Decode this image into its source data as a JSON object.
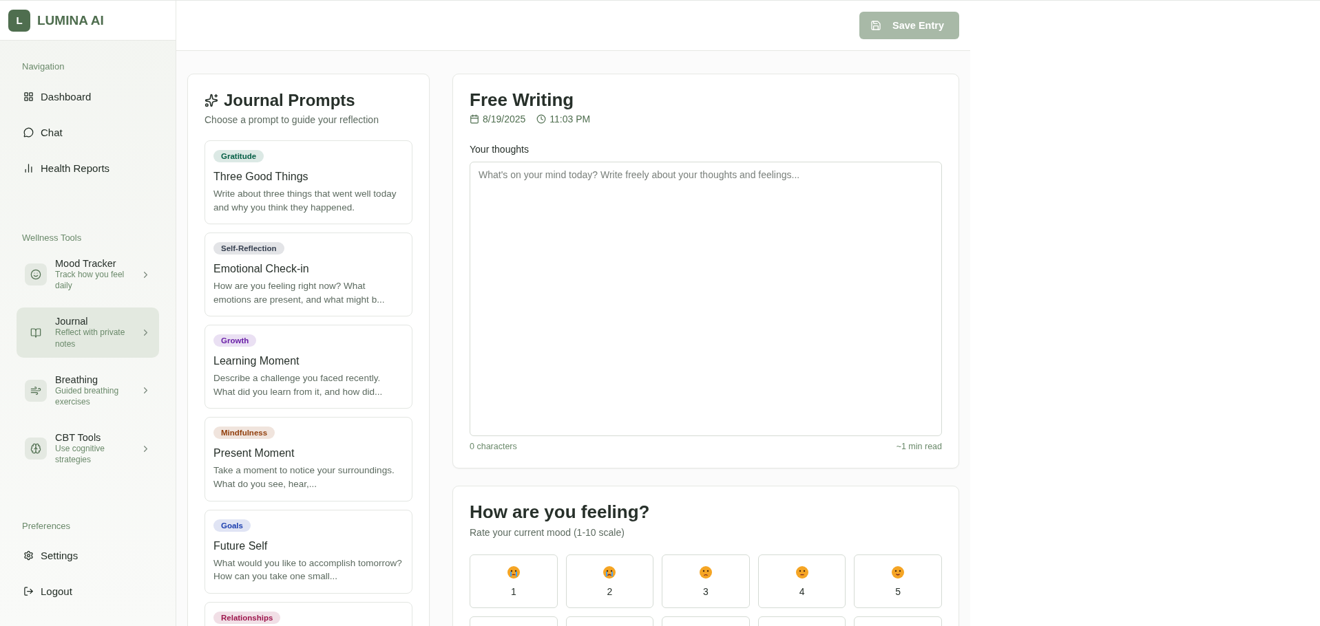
{
  "brand": {
    "logo_letter": "L",
    "name": "LUMINA AI"
  },
  "sidebar": {
    "sections": [
      {
        "title": "Navigation",
        "kind": "plain",
        "items": [
          {
            "label": "Dashboard"
          },
          {
            "label": "Chat"
          },
          {
            "label": "Health Reports"
          }
        ]
      },
      {
        "title": "Wellness Tools",
        "kind": "tool",
        "items": [
          {
            "label": "Mood Tracker",
            "subtitle": "Track how you feel daily",
            "selected": false
          },
          {
            "label": "Journal",
            "subtitle": "Reflect with private notes",
            "selected": true
          },
          {
            "label": "Breathing",
            "subtitle": "Guided breathing exercises",
            "selected": false
          },
          {
            "label": "CBT Tools",
            "subtitle": "Use cognitive strategies",
            "selected": false
          }
        ]
      },
      {
        "title": "Preferences",
        "kind": "plain",
        "items": [
          {
            "label": "Settings"
          },
          {
            "label": "Logout"
          }
        ]
      }
    ]
  },
  "toolbar": {
    "save_button": {
      "label": "Save Entry",
      "disabled": true
    }
  },
  "prompts": {
    "title": "Journal Prompts",
    "subtitle": "Choose a prompt to guide your reflection",
    "items": [
      {
        "tag": "Gratitude",
        "color": "#065f46",
        "title": "Three Good Things",
        "description": "Write about three things that went well today and why you think they happened."
      },
      {
        "tag": "Self-Reflection",
        "color": "#374151",
        "title": "Emotional Check-in",
        "description": "How are you feeling right now? What emotions are present, and what might b..."
      },
      {
        "tag": "Growth",
        "color": "#6b21a8",
        "title": "Learning Moment",
        "description": "Describe a challenge you faced recently. What did you learn from it, and how did..."
      },
      {
        "tag": "Mindfulness",
        "color": "#92400e",
        "title": "Present Moment",
        "description": "Take a moment to notice your surroundings. What do you see, hear,..."
      },
      {
        "tag": "Goals",
        "color": "#1e40af",
        "title": "Future Self",
        "description": "What would you like to accomplish tomorrow? How can you take one small..."
      },
      {
        "tag": "Relationships",
        "color": "#9d174d"
      }
    ]
  },
  "editor": {
    "title": "Free Writing",
    "date": "8/19/2025",
    "time": "11:03 PM",
    "field_label": "Your thoughts",
    "placeholder": "What's on your mind today? Write freely about your thoughts and feelings...",
    "char_count": "0 characters",
    "read_time": "~1 min read"
  },
  "mood": {
    "title": "How are you feeling?",
    "subtitle": "Rate your current mood (1-10 scale)",
    "options": [
      {
        "label": "1",
        "selected": false
      },
      {
        "label": "2",
        "selected": false
      },
      {
        "label": "3",
        "selected": false
      },
      {
        "label": "4",
        "selected": false
      },
      {
        "label": "5",
        "selected": false
      }
    ]
  }
}
